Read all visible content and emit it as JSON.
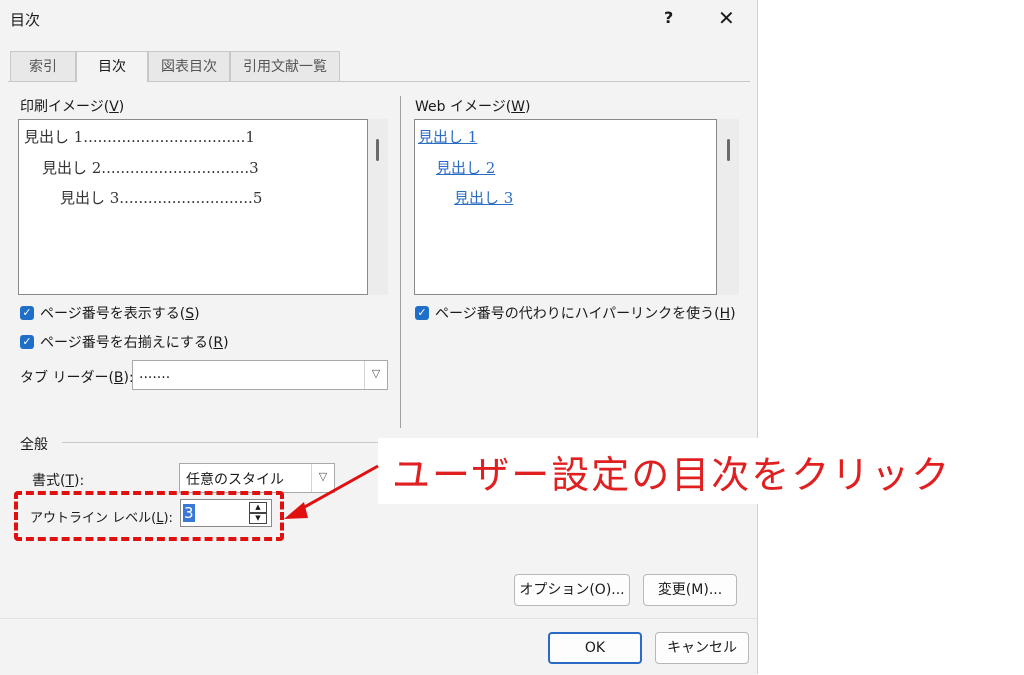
{
  "window": {
    "title": "目次",
    "help": "?",
    "close": "✕"
  },
  "tabs": [
    {
      "label": "索引",
      "active": false
    },
    {
      "label": "目次",
      "active": true
    },
    {
      "label": "図表目次",
      "active": false
    },
    {
      "label": "引用文献一覧",
      "active": false
    }
  ],
  "print_preview": {
    "label_main": "印刷イメージ(",
    "label_key": "V",
    "label_end": ")",
    "lines": [
      "見出し 1..................................1",
      "見出し 2...............................3",
      "見出し 3............................5"
    ]
  },
  "web_preview": {
    "label_main": "Web イメージ(",
    "label_key": "W",
    "label_end": ")",
    "lines": [
      "見出し 1",
      "見出し 2",
      "見出し 3"
    ]
  },
  "options": {
    "show_page_numbers": {
      "label_main": "ページ番号を表示する(",
      "key": "S",
      "label_end": ")",
      "checked": true
    },
    "right_align": {
      "label_main": "ページ番号を右揃えにする(",
      "key": "R",
      "label_end": ")",
      "checked": true
    },
    "hyperlinks": {
      "label_main": "ページ番号の代わりにハイパーリンクを使う(",
      "key": "H",
      "label_end": ")",
      "checked": true
    },
    "tab_leader": {
      "label_main": "タブ リーダー(",
      "key": "B",
      "label_end": "):",
      "value": "......."
    }
  },
  "general": {
    "heading": "全般",
    "format": {
      "label_main": "書式(",
      "key": "T",
      "label_end": "):",
      "value": "任意のスタイル"
    },
    "outline_level": {
      "label_main": "アウトライン レベル(",
      "key": "L",
      "label_end": "):",
      "value": "3"
    }
  },
  "annotation": {
    "text": "ユーザー設定の目次をクリック",
    "color": "#e02020"
  },
  "buttons": {
    "options": "オプション(O)...",
    "modify": "変更(M)...",
    "ok": "OK",
    "cancel": "キャンセル"
  },
  "colors": {
    "accent": "#1f6fc9",
    "link": "#2b6cc4",
    "highlight": "#e01010"
  }
}
